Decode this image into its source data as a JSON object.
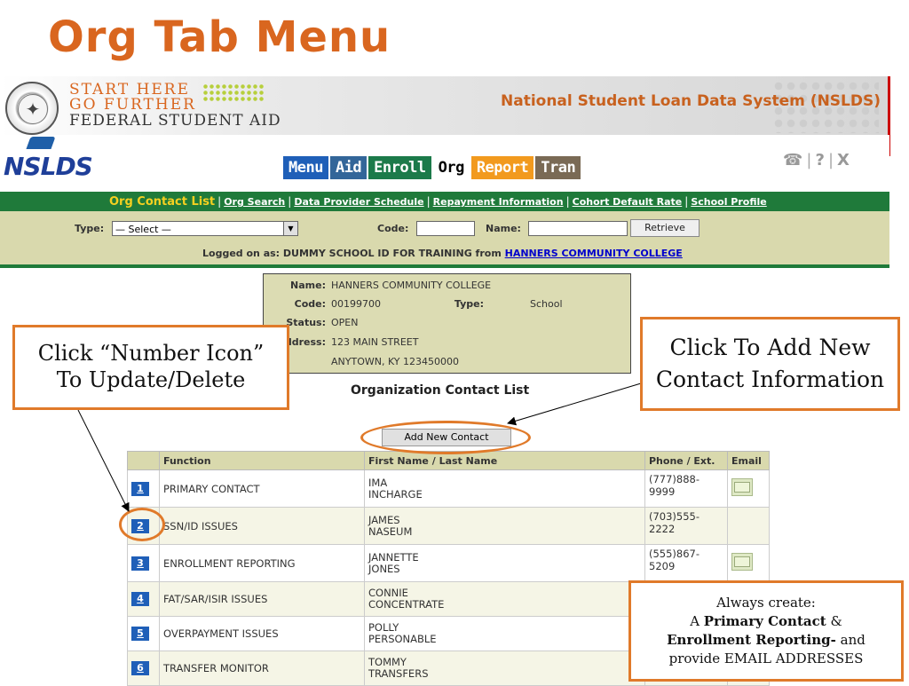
{
  "slide": {
    "title": "Org Tab Menu"
  },
  "banner": {
    "line1": "START HERE",
    "line2": "GO FURTHER",
    "line3": "FEDERAL STUDENT AID",
    "system_title": "National Student Loan Data System (NSLDS)"
  },
  "nav": {
    "logo": "NSLDS",
    "tabs": [
      "Menu",
      "Aid",
      "Enroll",
      "Org",
      "Report",
      "Tran"
    ],
    "util_icons": [
      "phone-icon",
      "help-icon",
      "close-icon"
    ]
  },
  "subnav": {
    "current": "Org Contact List",
    "links": [
      "Org Search",
      "Data Provider Schedule",
      "Repayment Information",
      "Cohort Default Rate",
      "School Profile"
    ]
  },
  "filter": {
    "type_label": "Type:",
    "type_value": "— Select —",
    "code_label": "Code:",
    "code_value": "",
    "name_label": "Name:",
    "name_value": "",
    "retrieve_label": "Retrieve",
    "logged_prefix": "Logged on as: DUMMY SCHOOL ID FOR TRAINING from ",
    "logged_school": "HANNERS COMMUNITY COLLEGE"
  },
  "school": {
    "name_label": "Name:",
    "name": "HANNERS COMMUNITY COLLEGE",
    "code_label": "Code:",
    "code": "00199700",
    "type_label": "Type:",
    "type": "School",
    "status_label": "Status:",
    "status": "OPEN",
    "address_label": "ddress:",
    "address1": "123 MAIN STREET",
    "address2": "ANYTOWN, KY 123450000"
  },
  "contacts": {
    "title": "Organization Contact List",
    "add_button": "Add New Contact",
    "headers": [
      "",
      "Function",
      "First Name / Last Name",
      "Phone / Ext.",
      "Email"
    ],
    "rows": [
      {
        "num": "1",
        "function": "PRIMARY CONTACT",
        "first": "IMA",
        "last": "INCHARGE",
        "phone": "(777)888-9999",
        "email": true
      },
      {
        "num": "2",
        "function": "SSN/ID ISSUES",
        "first": "JAMES",
        "last": "NASEUM",
        "phone": "(703)555-2222",
        "email": false
      },
      {
        "num": "3",
        "function": "ENROLLMENT REPORTING",
        "first": "JANNETTE",
        "last": "JONES",
        "phone": "(555)867-5209",
        "email": true
      },
      {
        "num": "4",
        "function": "FAT/SAR/ISIR ISSUES",
        "first": "CONNIE",
        "last": "CONCENTRATE",
        "phone": "",
        "email": false
      },
      {
        "num": "5",
        "function": "OVERPAYMENT ISSUES",
        "first": "POLLY",
        "last": "PERSONABLE",
        "phone": "",
        "email": false
      },
      {
        "num": "6",
        "function": "TRANSFER MONITOR",
        "first": "TOMMY",
        "last": "TRANSFERS",
        "phone": "",
        "email": false
      }
    ]
  },
  "callouts": {
    "left_line1": "Click “Number Icon”",
    "left_line2": "To Update/Delete",
    "right_line1": "Click To Add New",
    "right_line2": "Contact Information",
    "bottom_line1": "Always create:",
    "bottom_a": "A ",
    "bottom_primary": "Primary Contact",
    "bottom_amp": " &",
    "bottom_enroll": "Enrollment Reporting-",
    "bottom_and": " and",
    "bottom_line4": "provide EMAIL ADDRESSES"
  },
  "colors": {
    "accent": "#d9661f",
    "green": "#1f7a3a",
    "tan": "#d9d9ad",
    "blue": "#1f5fb8"
  }
}
